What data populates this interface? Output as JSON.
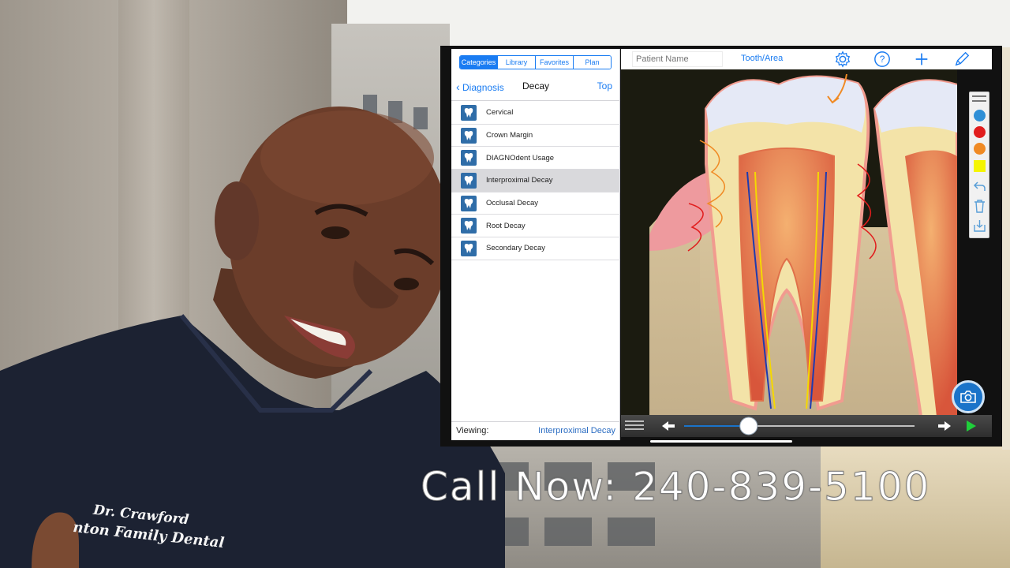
{
  "segmented": {
    "tabs": [
      {
        "label": "Categories",
        "active": true
      },
      {
        "label": "Library",
        "active": false
      },
      {
        "label": "Favorites",
        "active": false
      },
      {
        "label": "Plan",
        "active": false
      }
    ]
  },
  "nav": {
    "back_label": "Diagnosis",
    "title": "Decay",
    "top_label": "Top"
  },
  "list": {
    "items": [
      {
        "label": "Cervical"
      },
      {
        "label": "Crown Margin"
      },
      {
        "label": "DIAGNOdent Usage"
      },
      {
        "label": "Interproximal Decay",
        "selected": true
      },
      {
        "label": "Occlusal Decay"
      },
      {
        "label": "Root Decay"
      },
      {
        "label": "Secondary Decay"
      }
    ]
  },
  "viewing": {
    "label": "Viewing:",
    "value": "Interproximal Decay"
  },
  "toolbar": {
    "patient_placeholder": "Patient Name",
    "tooth_area": "Tooth/Area",
    "icons": [
      "gear-icon",
      "help-icon",
      "plus-icon",
      "pencil-icon"
    ]
  },
  "palette": {
    "colors": [
      "#2f8fd6",
      "#e11d1d",
      "#f08a24",
      "#f5f500"
    ],
    "tools": [
      "undo-icon",
      "trash-icon",
      "save-icon"
    ]
  },
  "player": {
    "progress": 0.28
  },
  "shirt": {
    "line1": "Dr. Crawford",
    "line2": "nton Family Dental"
  },
  "caption": "Call Now: 240-839-5100",
  "colors": {
    "accent": "#1a7cf2",
    "scrub_blue": "#1a73c9"
  }
}
